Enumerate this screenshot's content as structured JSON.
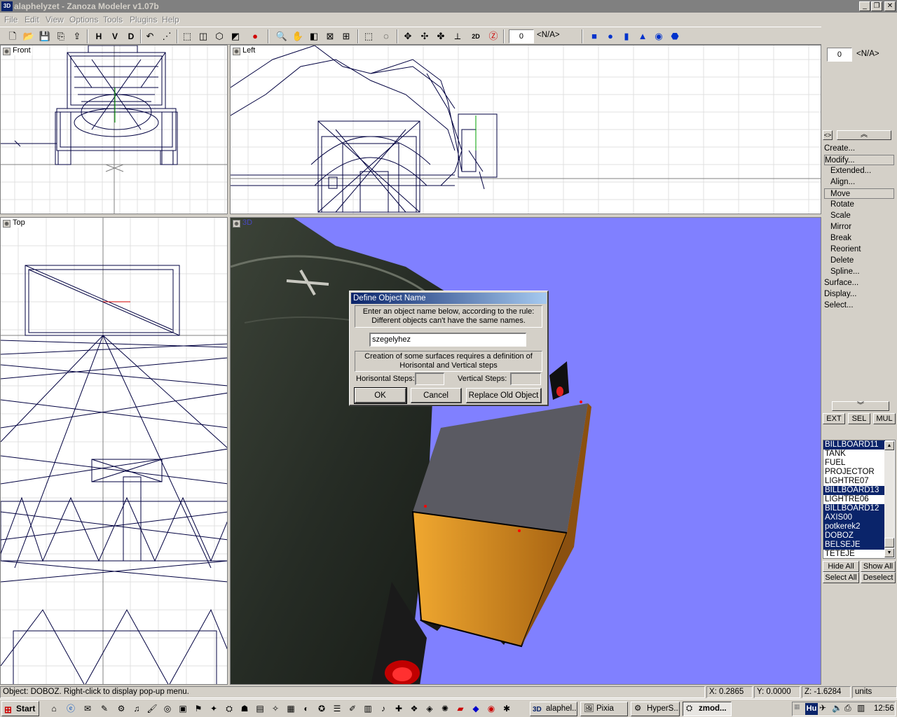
{
  "window": {
    "title": "alaphelyzet - Zanoza Modeler v1.07b",
    "app_icon_text": "3D",
    "minimize": "_",
    "restore": "❐",
    "close": "✕"
  },
  "menu": [
    "File",
    "Edit",
    "View",
    "Options",
    "Tools",
    "Plugins",
    "Help"
  ],
  "toolbar": {
    "h_label": "H",
    "v_label": "V",
    "d_label": "D",
    "spinner_value": "0",
    "na_label": "<N/A>"
  },
  "viewports": {
    "front": "Front",
    "left": "Left",
    "top": "Top",
    "persp": "3D"
  },
  "right_panel": {
    "spinner_value": "0",
    "na_label": "<N/A>",
    "toggle_label": "<>",
    "commands": [
      {
        "label": "Create...",
        "sub": false
      },
      {
        "label": "Modify...",
        "sub": false
      },
      {
        "label": "Extended...",
        "sub": true
      },
      {
        "label": "Align...",
        "sub": true
      },
      {
        "label": "Move",
        "sub": true
      },
      {
        "label": "Rotate",
        "sub": true
      },
      {
        "label": "Scale",
        "sub": true
      },
      {
        "label": "Mirror",
        "sub": true
      },
      {
        "label": "Break",
        "sub": true
      },
      {
        "label": "Reorient",
        "sub": true
      },
      {
        "label": "Delete",
        "sub": true
      },
      {
        "label": "Spline...",
        "sub": true
      },
      {
        "label": "Surface...",
        "sub": false
      },
      {
        "label": "Display...",
        "sub": false
      },
      {
        "label": "Select...",
        "sub": false
      }
    ],
    "mode_buttons": [
      "EXT",
      "SEL",
      "MUL"
    ],
    "objects": [
      {
        "name": "BILLBOARD11",
        "selected": true
      },
      {
        "name": "TANK",
        "selected": false
      },
      {
        "name": "FUEL",
        "selected": false
      },
      {
        "name": "PROJECTOR",
        "selected": false
      },
      {
        "name": "LIGHTRE07",
        "selected": false
      },
      {
        "name": "BILLBOARD13",
        "selected": true
      },
      {
        "name": "LIGHTRE06",
        "selected": false
      },
      {
        "name": "BILLBOARD12",
        "selected": true
      },
      {
        "name": "AXIS00",
        "selected": true
      },
      {
        "name": "potkerek2",
        "selected": true
      },
      {
        "name": "DOBOZ",
        "selected": true
      },
      {
        "name": "BELSEJE",
        "selected": true
      },
      {
        "name": "TETEJE",
        "selected": false
      }
    ],
    "hide_all": "Hide All",
    "show_all": "Show All",
    "select_all": "Select All",
    "deselect": "Deselect"
  },
  "dialog": {
    "title": "Define Object Name",
    "rule_line1": "Enter an object name below, according to the rule:",
    "rule_line2": "Different objects can't have the same names.",
    "name_value": "szegelyhez",
    "steps_line1": "Creation of some surfaces requires a definition of",
    "steps_line2": "Horisontal and Vertical steps",
    "h_steps_label": "Horisontal Steps:",
    "v_steps_label": "Vertical Steps:",
    "ok": "OK",
    "cancel": "Cancel",
    "replace": "Replace Old Object"
  },
  "status": {
    "message": "Object: DOBOZ. Right-click to display pop-up menu.",
    "x": "X: 0.2865",
    "y": "Y: 0.0000",
    "z": "Z: -1.6284",
    "units": "units"
  },
  "taskbar": {
    "start": "Start",
    "tasks": [
      {
        "label": "alaphel...",
        "active": false
      },
      {
        "label": "Pixia",
        "active": false
      },
      {
        "label": "HyperS...",
        "active": false
      },
      {
        "label": "zmod...",
        "active": true
      }
    ],
    "lang": "Hu",
    "clock": "12:56"
  },
  "colors": {
    "viewport_bg": "#ffffff",
    "persp_bg": "#8080ff",
    "selection": "#0a246a",
    "wireframe": "#000040"
  }
}
